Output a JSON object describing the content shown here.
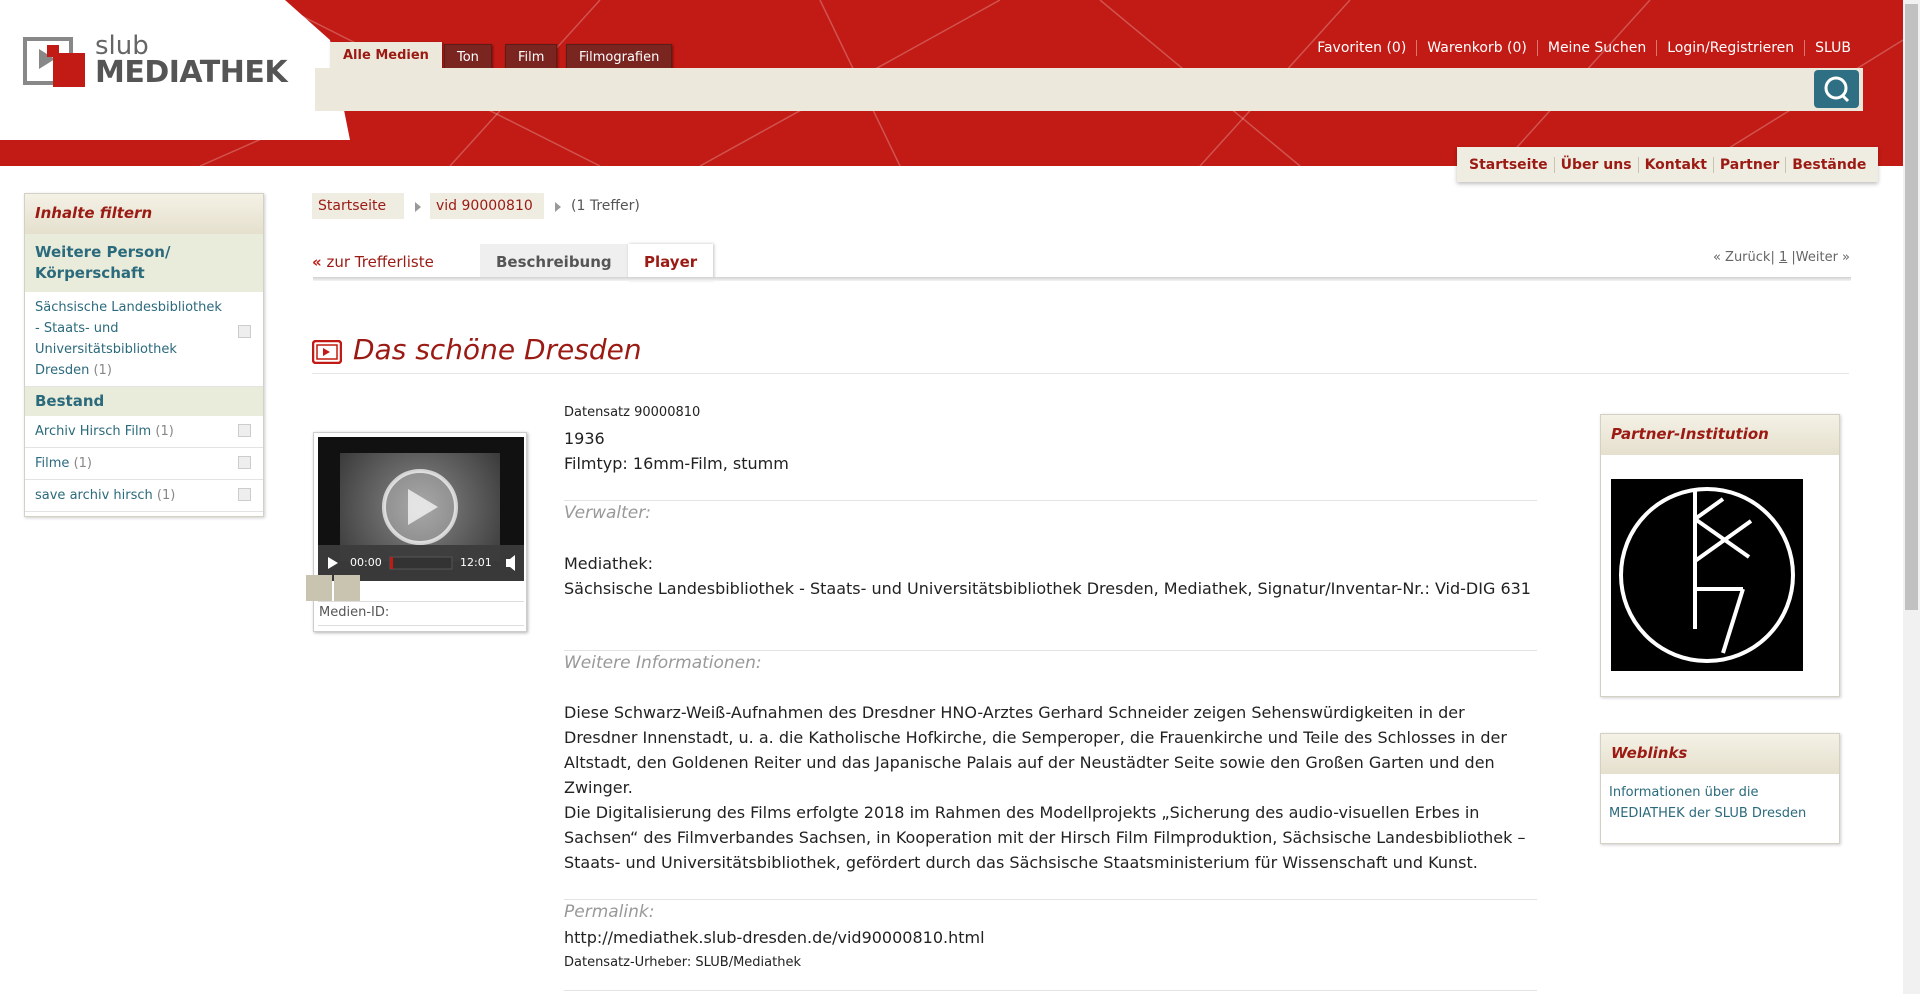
{
  "logo": {
    "line1": "slub",
    "line2": "MEDIATHEK"
  },
  "media_tabs": [
    "Alle Medien",
    "Ton",
    "Film",
    "Filmografien"
  ],
  "top_nav": [
    "Favoriten (0)",
    "Warenkorb (0)",
    "Meine Suchen",
    "Login/Registrieren",
    "SLUB"
  ],
  "sub_nav": [
    "Startseite",
    "Über uns",
    "Kontakt",
    "Partner",
    "Bestände"
  ],
  "sidebar": {
    "title": "Inhalte filtern",
    "group1": "Weitere Person/ Körperschaft",
    "group1_items": [
      {
        "label": "Sächsische Landesbibliothek - Staats- und Universitätsbibliothek Dresden",
        "count": "(1)"
      }
    ],
    "group2": "Bestand",
    "group2_items": [
      {
        "label": "Archiv Hirsch Film",
        "count": "(1)"
      },
      {
        "label": "Filme",
        "count": "(1)"
      },
      {
        "label": "save archiv hirsch",
        "count": "(1)"
      }
    ]
  },
  "breadcrumb": {
    "home": "Startseite",
    "query": "vid 90000810",
    "hits": "(1 Treffer)"
  },
  "tabs": {
    "back": "zur Trefferliste",
    "description": "Beschreibung",
    "player": "Player"
  },
  "pager": {
    "prev": "« Zurück",
    "page": "1",
    "next": "Weiter »"
  },
  "title": "Das schöne Dresden",
  "player": {
    "time_current": "00:00",
    "time_total": "12:01",
    "media_id_label": "Medien-ID:"
  },
  "record": {
    "id": "Datensatz 90000810",
    "year": "1936",
    "filmtype": "Filmtyp: 16mm-Film, stumm",
    "verwalter_label": "Verwalter:",
    "mediathek_label": "Mediathek:",
    "mediathek_value": "Sächsische Landesbibliothek - Staats- und Universitätsbibliothek Dresden, Mediathek, Signatur/Inventar-Nr.: Vid-DIG 631",
    "weitere_label": "Weitere Informationen:",
    "para1": "Diese Schwarz-Weiß-Aufnahmen des Dresdner HNO-Arztes Gerhard Schneider zeigen Sehenswürdigkeiten in der Dresdner Innenstadt, u. a. die Katholische Hofkirche, die Semperoper, die Frauenkirche und Teile des Schlosses in der Altstadt, den Goldenen Reiter und das Japanische Palais auf der Neustädter Seite sowie den Großen Garten und den Zwinger.",
    "para2": "Die Digitalisierung des Films erfolgte 2018 im Rahmen des Modellprojekts „Sicherung des audio-visuellen Erbes in Sachsen“ des Filmverbandes Sachsen, in Kooperation mit der Hirsch Film Filmproduktion, Sächsische Landesbibliothek – Staats- und Universitätsbibliothek, gefördert durch das Sächsische Staatsministerium für Wissenschaft und Kunst.",
    "permalink_label": "Permalink:",
    "permalink": "http://mediathek.slub-dresden.de/vid90000810.html",
    "urheber": "Datensatz-Urheber: SLUB/Mediathek"
  },
  "partner": {
    "title": "Partner-Institution"
  },
  "weblinks": {
    "title": "Weblinks",
    "link": "Informationen über die MEDIATHEK der SLUB Dresden"
  },
  "colors": {
    "brand_red": "#c21a14",
    "link_teal": "#2b6a7c",
    "dark_red": "#9b1a13",
    "beige": "#ece9dc"
  }
}
